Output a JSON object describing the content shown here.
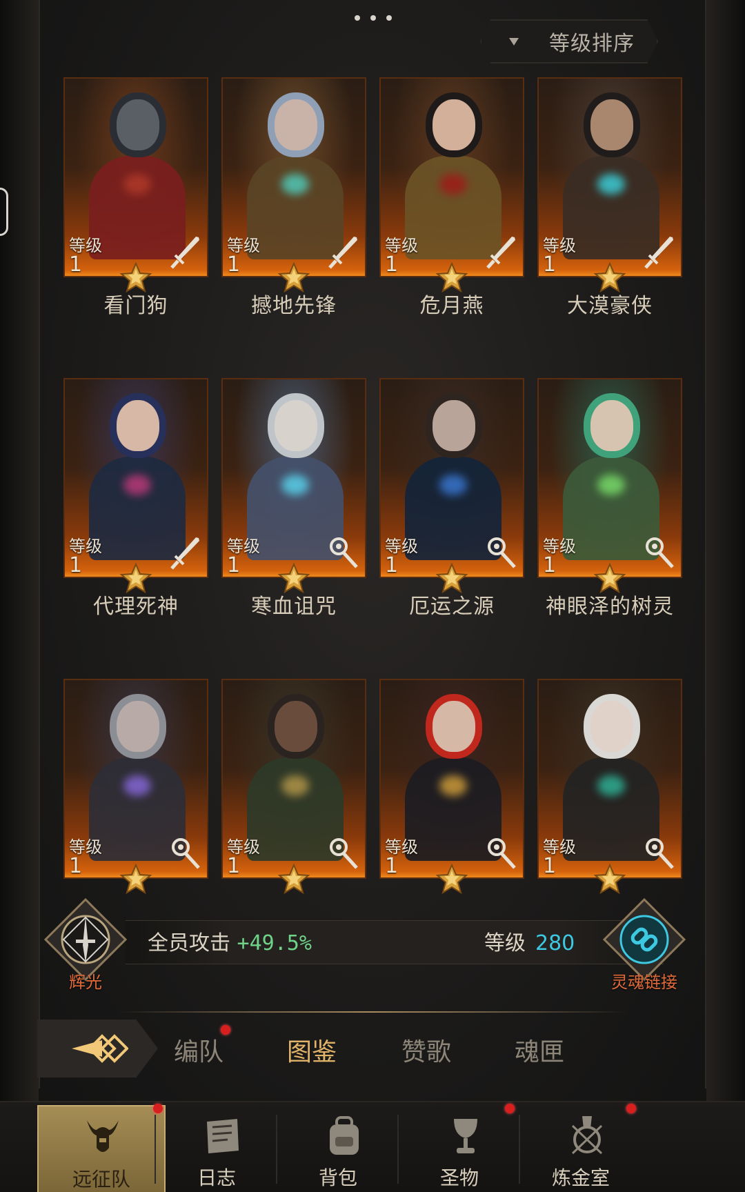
{
  "toolbar": {
    "more_icon": "more-dots-icon"
  },
  "sort": {
    "label": "等级排序",
    "icon": "triangle-down-icon"
  },
  "level_label": "等级",
  "heroes": [
    {
      "name": "看门狗",
      "level": "1",
      "type": "sword",
      "skin": "#5a5f66",
      "hair": "#2a2d33",
      "cloth": "#7a1e1e",
      "accent": "#b23a2a",
      "glow": "#6b3a1c"
    },
    {
      "name": "撼地先锋",
      "level": "1",
      "type": "sword",
      "skin": "#c9b3a8",
      "hair": "#8fa0b6",
      "cloth": "#5a4426",
      "accent": "#4fd0c0",
      "glow": "#6b4a2a"
    },
    {
      "name": "危月燕",
      "level": "1",
      "type": "sword",
      "skin": "#d2b09a",
      "hair": "#1e1a1a",
      "cloth": "#6b5226",
      "accent": "#a01818",
      "glow": "#5e3a20"
    },
    {
      "name": "大漠豪侠",
      "level": "1",
      "type": "sword",
      "skin": "#a9876e",
      "hair": "#201c1b",
      "cloth": "#3a2c24",
      "accent": "#3ad6e0",
      "glow": "#4a3a30"
    },
    {
      "name": "代理死神",
      "level": "1",
      "type": "sword",
      "skin": "#d7b7a6",
      "hair": "#27305a",
      "cloth": "#1e2a40",
      "accent": "#c23a7a",
      "glow": "#3a3450"
    },
    {
      "name": "寒血诅咒",
      "level": "1",
      "type": "staff",
      "skin": "#d8d2cd",
      "hair": "#bfc4c9",
      "cloth": "#44506a",
      "accent": "#5ad6f0",
      "glow": "#4a5a70"
    },
    {
      "name": "厄运之源",
      "level": "1",
      "type": "staff",
      "skin": "#b9a49a",
      "hair": "#2e2420",
      "cloth": "#14243a",
      "accent": "#3a7ad6",
      "glow": "#3a2a22"
    },
    {
      "name": "神眼泽的树灵",
      "level": "1",
      "type": "staff",
      "skin": "#d6c4b0",
      "hair": "#3fa27a",
      "cloth": "#3c5a3a",
      "accent": "#7ae06a",
      "glow": "#2e5a48"
    },
    {
      "name": "",
      "level": "1",
      "type": "staff",
      "skin": "#b8aaa6",
      "hair": "#8c8e96",
      "cloth": "#2e2e36",
      "accent": "#8a6ae0",
      "glow": "#3a3440"
    },
    {
      "name": "",
      "level": "1",
      "type": "staff",
      "skin": "#6a4c3c",
      "hair": "#2a2320",
      "cloth": "#2e3a28",
      "accent": "#b89a4a",
      "glow": "#3a3426"
    },
    {
      "name": "",
      "level": "1",
      "type": "staff",
      "skin": "#d6b8a6",
      "hair": "#c0281e",
      "cloth": "#1c1c22",
      "accent": "#d6a23a",
      "glow": "#3a2420"
    },
    {
      "name": "",
      "level": "1",
      "type": "staff",
      "skin": "#e0d2c8",
      "hair": "#dad8d4",
      "cloth": "#232323",
      "accent": "#2fb89a",
      "glow": "#3a3024"
    }
  ],
  "bonus": {
    "left_emblem_icon": "sword-compass-icon",
    "left_caption": "辉光",
    "attack_label": "全员攻击",
    "attack_value": "+49.5%",
    "level_label": "等级",
    "level_value": "280",
    "right_emblem_icon": "chain-link-icon",
    "right_caption": "灵魂链接"
  },
  "subtabs": [
    {
      "label": "编队",
      "badge": true
    },
    {
      "label": "图鉴",
      "active": true
    },
    {
      "label": "赞歌"
    },
    {
      "label": "魂匣"
    }
  ],
  "nav": [
    {
      "label": "远征队",
      "icon": "horned-helmet-icon",
      "active": true,
      "badge": true
    },
    {
      "label": "日志",
      "icon": "scroll-icon"
    },
    {
      "label": "背包",
      "icon": "backpack-icon"
    },
    {
      "label": "圣物",
      "icon": "chalice-icon",
      "badge": true
    },
    {
      "label": "炼金室",
      "icon": "alchemy-icon",
      "badge": true
    }
  ],
  "colors": {
    "accent_gold": "#e1b46a",
    "bonus_green": "#6fd38a",
    "level_cyan": "#3ec9e3",
    "badge_red": "#d81f1f",
    "caption_orange": "#e06a3a"
  }
}
